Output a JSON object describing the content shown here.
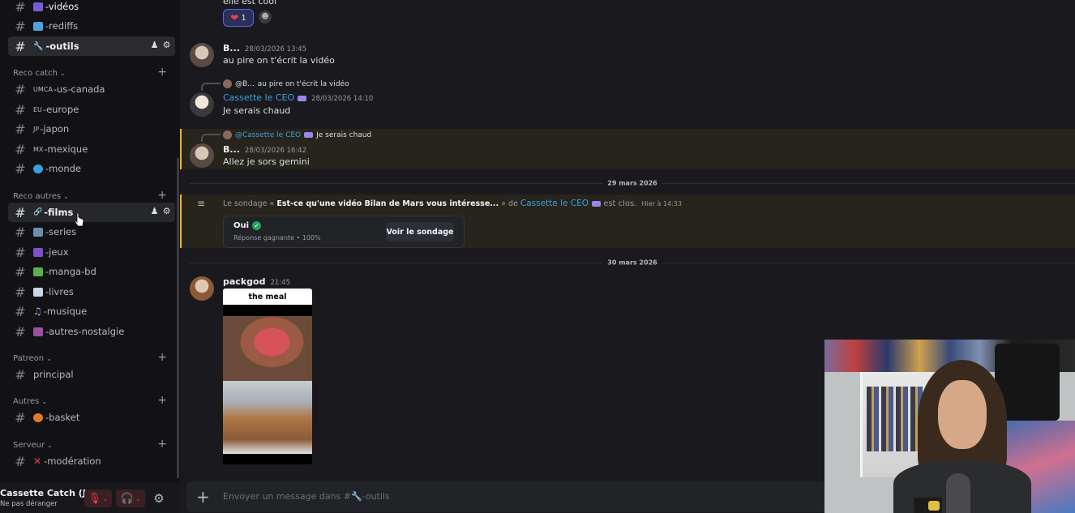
{
  "sidebar": {
    "channels_top": [
      {
        "name": "-vidéos",
        "emoji_color": "#7b5cd6"
      },
      {
        "name": "-rediffs",
        "emoji_color": "#4aa3df"
      },
      {
        "name": "-outils",
        "emoji": "🔧"
      }
    ],
    "categories": [
      {
        "label": "Reco catch",
        "channels": [
          {
            "name": "-us-canada",
            "prefix": "UMCA"
          },
          {
            "name": "-europe",
            "prefix": "EU"
          },
          {
            "name": "-japon",
            "prefix": "JP"
          },
          {
            "name": "-mexique",
            "prefix": "MX"
          },
          {
            "name": "-monde",
            "emoji_color": "#3aa0e0"
          }
        ]
      },
      {
        "label": "Reco autres",
        "channels": [
          {
            "name": "-films",
            "emoji": "🔗"
          },
          {
            "name": "-series",
            "emoji_color": "#6a8fb0"
          },
          {
            "name": "-jeux",
            "emoji_color": "#7a4fd0"
          },
          {
            "name": "-manga-bd",
            "emoji_color": "#5ab050"
          },
          {
            "name": "-livres",
            "emoji_color": "#c9d6e6"
          },
          {
            "name": "-musique",
            "emoji": "♫"
          },
          {
            "name": "-autres-nostalgie",
            "emoji_color": "#9a4fa0"
          }
        ]
      },
      {
        "label": "Patreon",
        "channels": [
          {
            "name": "principal"
          }
        ]
      },
      {
        "label": "Autres",
        "channels": [
          {
            "name": "-basket",
            "emoji_color": "#e07a2e"
          }
        ]
      },
      {
        "label": "Serveur",
        "channels": [
          {
            "name": "-modération",
            "emoji": "✕"
          }
        ]
      }
    ],
    "user": {
      "name": "Cassette Catch (J...",
      "status": "Ne pas déranger"
    }
  },
  "messages": {
    "top_text": "elle est cool",
    "reaction_count": "1",
    "m1": {
      "author": "B...",
      "time": "28/03/2026 13:45",
      "text": "au pire on t'écrit la vidéo"
    },
    "m2": {
      "reply_author": "@B...",
      "reply_text": "au pire on t'écrit la vidéo",
      "author": "Cassette le CEO",
      "time": "28/03/2026 14:10",
      "text": "Je serais chaud"
    },
    "m3": {
      "reply_author": "@Cassette le CEO",
      "reply_text": "Je serais chaud",
      "author": "B...",
      "time": "28/03/2026 16:42",
      "text": "Allez je sors gemini"
    },
    "date1": "29 mars 2026",
    "poll": {
      "prefix": "Le sondage « ",
      "question": "Est-ce qu'une vidéo Bilan de Mars vous intéresse...",
      "middle": " » de ",
      "author": "Cassette le CEO",
      "suffix": " est clos.",
      "time": "Hier à 14:33",
      "answer": "Oui",
      "result": "Réponse gagnante • 100%",
      "button": "Voir le sondage"
    },
    "date2": "30 mars 2026",
    "m4": {
      "author": "packgod",
      "time": "21:45",
      "media_caption": "the meal"
    }
  },
  "composer": {
    "placeholder": "Envoyer un message dans #🔧-outils"
  },
  "colors": {
    "accent_blue": "#3b9fe0",
    "highlight_border": "#f0b232",
    "background": "#1a1a1e"
  }
}
